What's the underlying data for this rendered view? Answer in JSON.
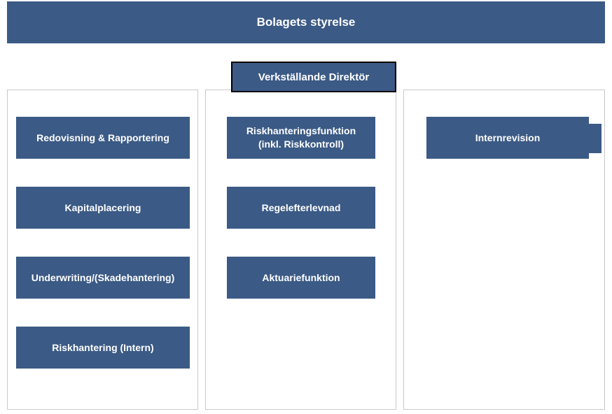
{
  "header": {
    "title": "Bolagets styrelse"
  },
  "vd": {
    "label": "Verkställande Direktör"
  },
  "columns": {
    "left": {
      "items": [
        {
          "label": "Redovisning & Rapportering"
        },
        {
          "label": "Kapitalplacering"
        },
        {
          "label": "Underwriting/(Skadehantering)"
        },
        {
          "label": "Riskhantering (Intern)"
        }
      ]
    },
    "middle": {
      "items": [
        {
          "label": "Riskhanteringsfunktion (inkl. Riskkontroll)"
        },
        {
          "label": "Regelefterlevnad"
        },
        {
          "label": "Aktuariefunktion"
        }
      ]
    },
    "right": {
      "items": [
        {
          "label": "Internrevision"
        }
      ]
    }
  }
}
